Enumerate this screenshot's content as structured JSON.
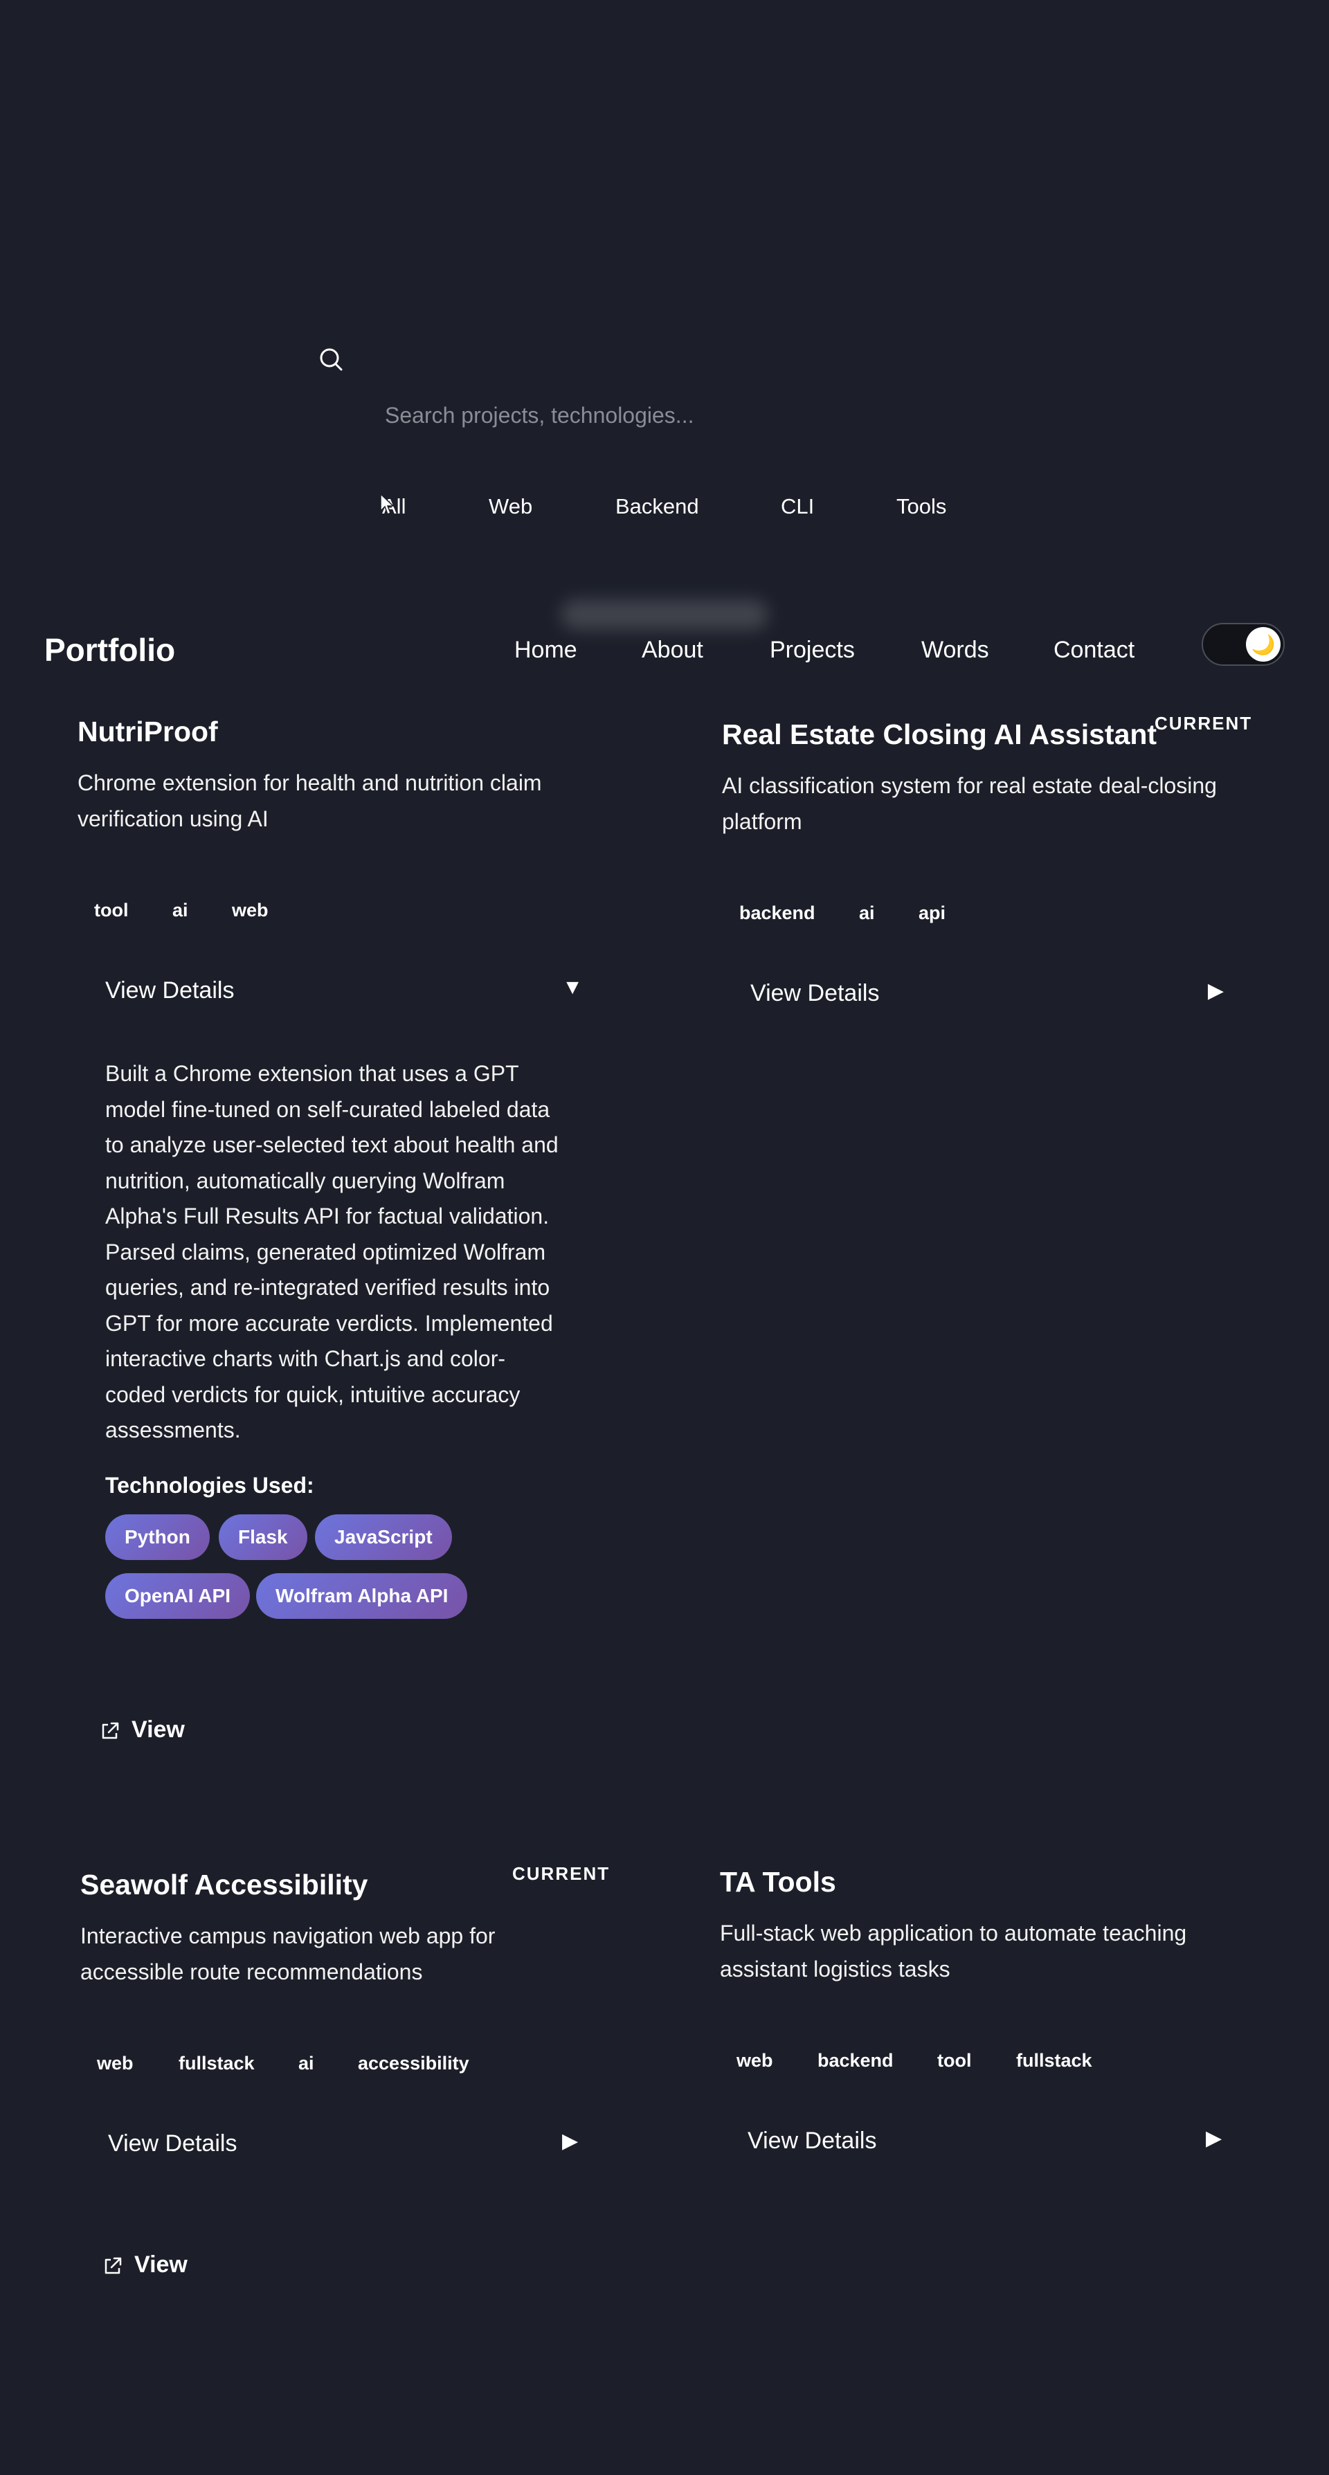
{
  "search": {
    "placeholder": "Search projects, technologies..."
  },
  "filters": [
    "All",
    "Web",
    "Backend",
    "CLI",
    "Tools"
  ],
  "navbar": {
    "logo": "Portfolio",
    "links": [
      "Home",
      "About",
      "Projects",
      "Words",
      "Contact"
    ],
    "theme_toggle_icon": "🌙"
  },
  "projects": [
    {
      "title": "NutriProof",
      "current": "",
      "description_lines": [
        "Chrome extension for health and nutrition claim",
        "verification using AI"
      ],
      "tags": [
        "tool",
        "ai",
        "web"
      ],
      "details_label": "View Details",
      "arrow": "▼",
      "details_lines": [
        "Built a Chrome extension that uses a GPT",
        "model fine-tuned on self-curated labeled data",
        "to analyze user-selected text about health and",
        "nutrition, automatically querying Wolfram",
        "Alpha's Full Results API for factual validation.",
        "Parsed claims, generated optimized Wolfram",
        "queries, and re-integrated verified results into",
        "GPT for more accurate verdicts. Implemented",
        "interactive charts with Chart.js and color-",
        "coded verdicts for quick, intuitive accuracy",
        "assessments."
      ],
      "tech_heading": "Technologies Used:",
      "technologies": [
        "Python",
        "Flask",
        "JavaScript",
        "OpenAI API",
        "Wolfram Alpha API"
      ],
      "view_label": "View"
    },
    {
      "title": "Real Estate Closing AI Assistant",
      "current": "CURRENT",
      "description_lines": [
        "AI classification system for real estate deal-closing",
        "platform"
      ],
      "tags": [
        "backend",
        "ai",
        "api"
      ],
      "details_label": "View Details",
      "arrow": "▶"
    },
    {
      "title": "Seawolf Accessibility",
      "current": "CURRENT",
      "description_lines": [
        "Interactive campus navigation web app for",
        "accessible route recommendations"
      ],
      "tags": [
        "web",
        "fullstack",
        "ai",
        "accessibility"
      ],
      "details_label": "View Details",
      "arrow": "▶",
      "view_label": "View"
    },
    {
      "title": "TA Tools",
      "current": "",
      "description_lines": [
        "Full-stack web application to automate teaching",
        "assistant logistics tasks"
      ],
      "tags": [
        "web",
        "backend",
        "tool",
        "fullstack"
      ],
      "details_label": "View Details",
      "arrow": "▶"
    }
  ]
}
